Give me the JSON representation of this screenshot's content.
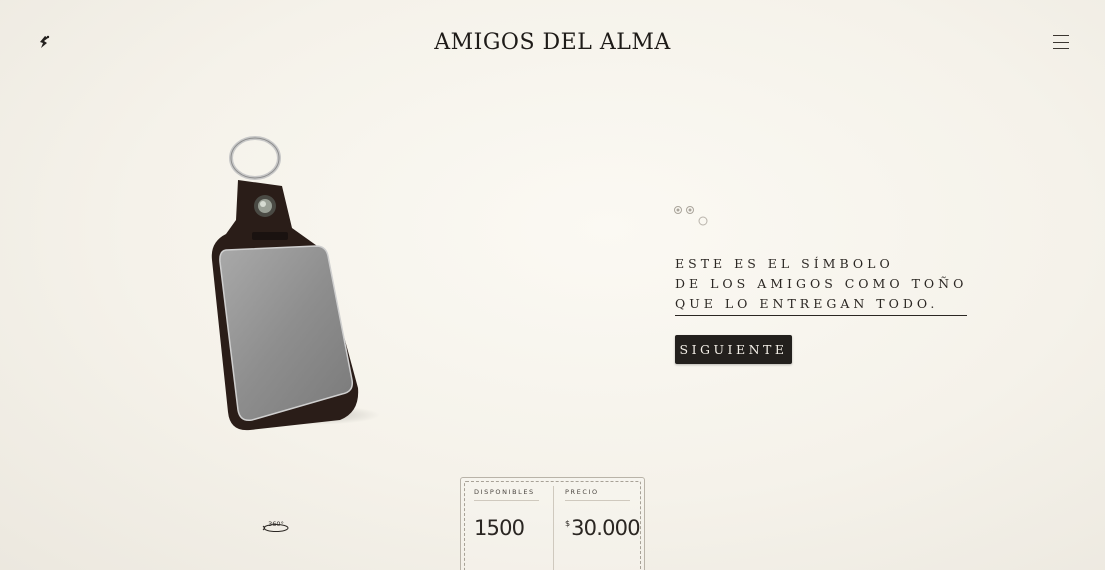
{
  "header": {
    "brand": "AMIGOS DEL ALMA",
    "logo_icon": "runner-logo-icon",
    "menu_icon": "hamburger-menu-icon"
  },
  "hero": {
    "headline_lines": [
      "ESTE ES EL SÍMBOLO",
      "DE LOS AMIGOS COMO TOÑO",
      "QUE LO ENTREGAN TODO."
    ],
    "next_button": "SIGUIENTE",
    "rotate_label": "360°"
  },
  "info": {
    "available_label": "DISPONIBLES",
    "available_value": "1500",
    "price_label": "PRECIO",
    "price_currency": "$",
    "price_value": "30.000"
  },
  "colors": {
    "background": "#f7f4ec",
    "button": "#23201d",
    "text": "#2b2723"
  }
}
